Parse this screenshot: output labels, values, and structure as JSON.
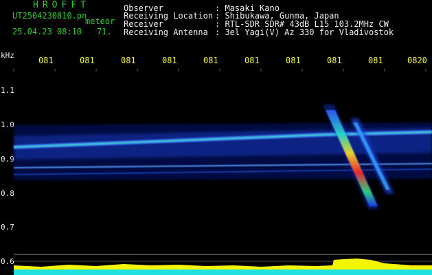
{
  "header": {
    "logo": "HROFFT",
    "filename": "UT2504230810.pn",
    "meteor_label": "meteor",
    "datetime": "25.04.23 08:10",
    "count": "71.",
    "fields": [
      {
        "label": "Observer",
        "value": ": Masaki Kano"
      },
      {
        "label": "Receiving Location",
        "value": ": Shibukawa, Gunma, Japan"
      },
      {
        "label": "Receiver",
        "value": ": RTL-SDR SDR# 43dB L15 103.2MHz CW"
      },
      {
        "label": "Receiving Antenna",
        "value": ": 3el Yagi(V) Az 330 for Vladivostok"
      }
    ]
  },
  "axis": {
    "unit": "kHz",
    "y_ticks": [
      "1.1",
      "1.0",
      "0.9",
      "0.8",
      "0.7",
      "0.6"
    ],
    "time_ticks": [
      "081",
      "081",
      "081",
      "081",
      "081",
      "081",
      "081",
      "081",
      "081",
      "0820"
    ]
  },
  "colors": {
    "text_white": "#f0f0f0",
    "text_green": "#33cc33",
    "time_yellow": "#f2f24a",
    "signal_blue": "#1a3cff",
    "signal_hot": "#ff2020",
    "power_yellow": "#f5f500",
    "power_cyan": "#20e0e0"
  }
}
